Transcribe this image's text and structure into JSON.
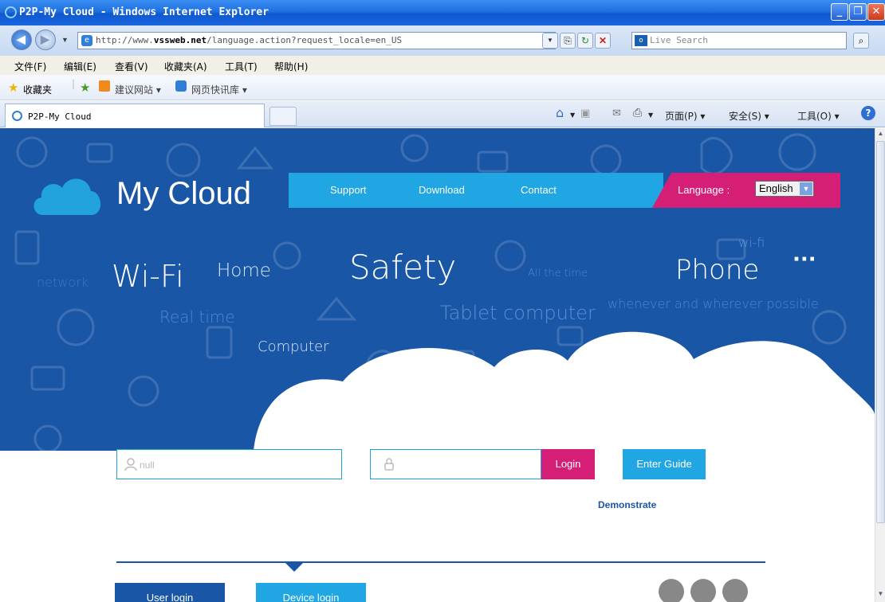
{
  "window": {
    "title": "P2P-My Cloud - Windows Internet Explorer"
  },
  "address_bar": {
    "url_prefix": "http://www.",
    "url_domain": "vssweb.net",
    "url_path": "/language.action?request_locale=en_US",
    "search_placeholder": "Live Search"
  },
  "menu": {
    "items": [
      "文件(F)",
      "编辑(E)",
      "查看(V)",
      "收藏夹(A)",
      "工具(T)",
      "帮助(H)"
    ]
  },
  "favorites_bar": {
    "favorites_label": "收藏夹",
    "suggested_sites": "建议网站 ▾",
    "web_slice": "网页快讯库 ▾"
  },
  "tabs": {
    "active_tab": "P2P-My Cloud"
  },
  "command_bar": {
    "page": "页面(P) ▾",
    "safety": "安全(S) ▾",
    "tools": "工具(O) ▾"
  },
  "site": {
    "logo_text": "My Cloud",
    "nav": [
      "Support",
      "Download",
      "Contact"
    ],
    "language_label": "Language :",
    "language_value": "English",
    "words": {
      "network": "network",
      "wifi": "Wi-Fi",
      "home": "Home",
      "safety": "Safety",
      "all_the_time": "All the time",
      "phone": "Phone",
      "wifi_small": "wi-fi",
      "dots": "···",
      "real_time": "Real time",
      "tablet": "Tablet computer",
      "whenever": "whenever and wherever possible",
      "computer": "Computer"
    },
    "login": {
      "username_placeholder": "null",
      "login_button": "Login",
      "guide_button": "Enter Guide",
      "demo_link": "Demonstrate",
      "user_login_tab": "User login",
      "device_login_tab": "Device login"
    }
  },
  "colors": {
    "banner_blue": "#1a56a6",
    "accent_cyan": "#20a6e2",
    "accent_magenta": "#d51f76"
  }
}
